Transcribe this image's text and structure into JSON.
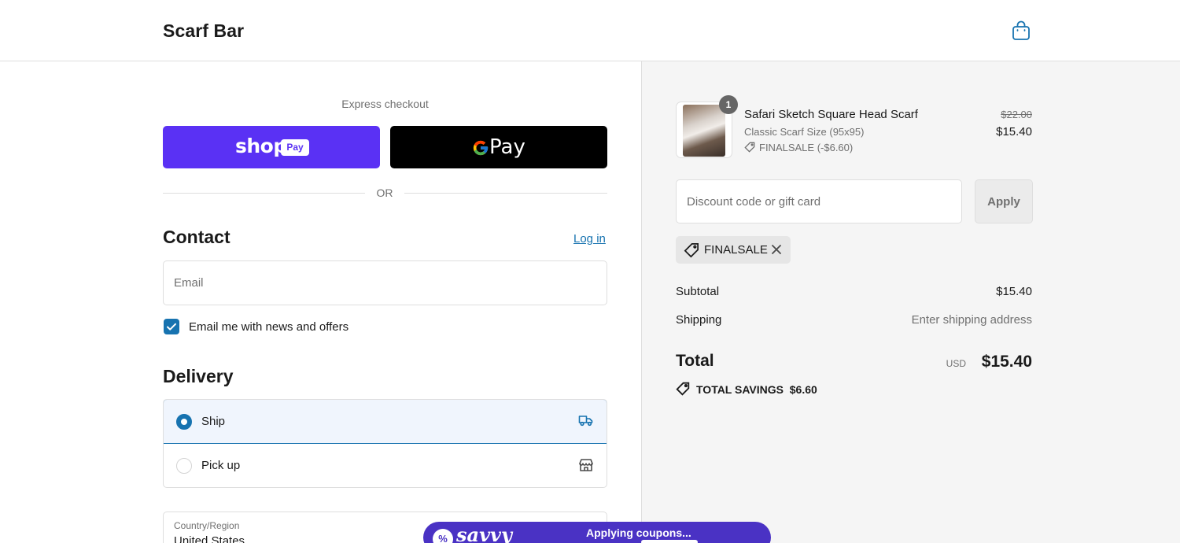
{
  "header": {
    "store_name": "Scarf Bar",
    "cart_icon": "shopping-bag-icon"
  },
  "express": {
    "label": "Express checkout",
    "shop_pay": {
      "word": "shop",
      "pill": "Pay"
    },
    "google_pay": {
      "word": "Pay"
    },
    "divider": "OR"
  },
  "contact": {
    "heading": "Contact",
    "login": "Log in",
    "email_placeholder": "Email",
    "news_opt_in": "Email me with news and offers",
    "news_checked": true
  },
  "delivery": {
    "heading": "Delivery",
    "options": [
      {
        "label": "Ship",
        "selected": true,
        "icon": "truck-icon"
      },
      {
        "label": "Pick up",
        "selected": false,
        "icon": "store-icon"
      }
    ],
    "country_label": "Country/Region",
    "country_value": "United States"
  },
  "order": {
    "item": {
      "quantity": "1",
      "title": "Safari Sketch Square Head Scarf",
      "variant": "Classic Scarf Size (95x95)",
      "discount": "FINALSALE (-$6.60)",
      "original_price": "$22.00",
      "price": "$15.40"
    },
    "discount_placeholder": "Discount code or gift card",
    "apply_label": "Apply",
    "applied_code": "FINALSALE",
    "subtotal_label": "Subtotal",
    "subtotal_value": "$15.40",
    "shipping_label": "Shipping",
    "shipping_value": "Enter shipping address",
    "total_label": "Total",
    "total_currency": "USD",
    "total_value": "$15.40",
    "savings_label": "TOTAL SAVINGS",
    "savings_value": "$6.60"
  },
  "savvy": {
    "logo": "savvy",
    "badge": "%",
    "status": "Applying coupons..."
  },
  "colors": {
    "accent": "#1773b0",
    "shop_pay": "#5a31f4",
    "savvy": "#4a32c4"
  }
}
